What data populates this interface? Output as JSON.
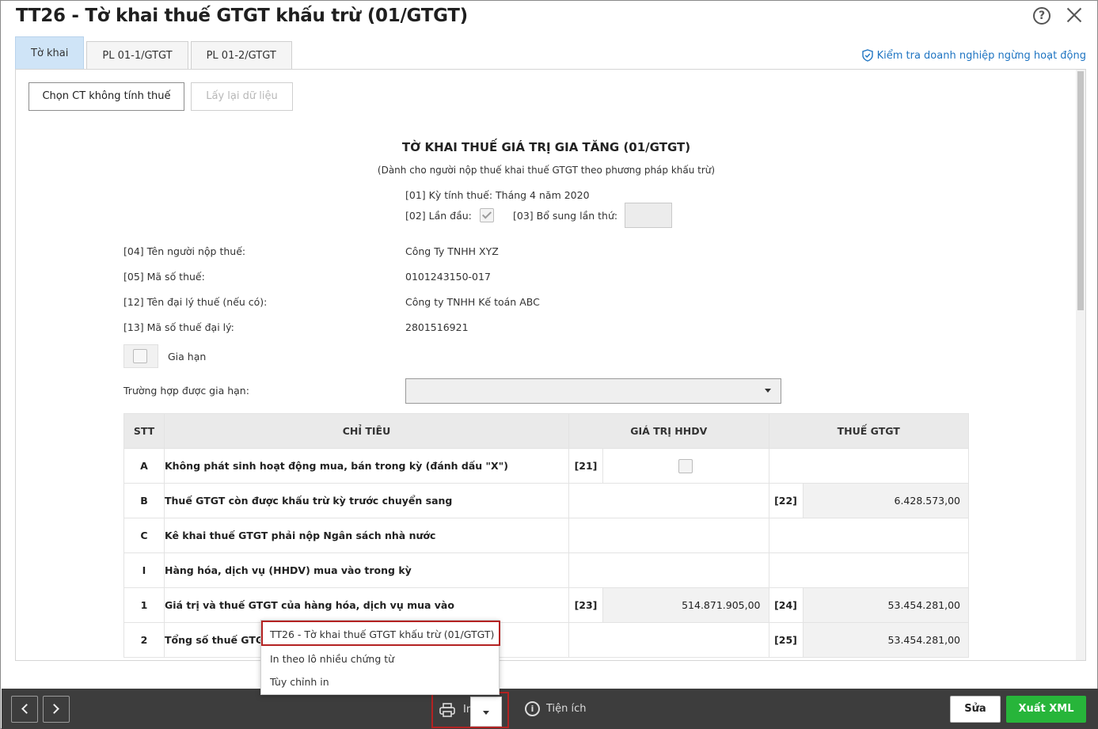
{
  "window": {
    "title": "TT26 - Tờ khai thuế GTGT khấu trừ (01/GTGT)"
  },
  "tabs": [
    "Tờ khai",
    "PL 01-1/GTGT",
    "PL 01-2/GTGT"
  ],
  "check_business_link": "Kiểm tra doanh nghiệp ngừng hoạt động",
  "toolbar": {
    "choose_btn": "Chọn CT không tính thuế",
    "reload_btn": "Lấy lại dữ liệu"
  },
  "form": {
    "title": "TỜ KHAI THUẾ GIÁ TRỊ GIA TĂNG (01/GTGT)",
    "subtitle": "(Dành cho người nộp thuế khai thuế GTGT theo phương pháp khấu trừ)",
    "period": "[01] Kỳ tính thuế: Tháng 4 năm 2020",
    "first_time_label": "[02] Lần đầu:",
    "supplement_label": "[03] Bổ sung lần thứ:",
    "supplement_value": "",
    "fields": [
      {
        "label": "[04] Tên người nộp thuế:",
        "value": "Công Ty TNHH XYZ"
      },
      {
        "label": "[05] Mã số thuế:",
        "value": "0101243150-017"
      },
      {
        "label": "[12] Tên đại lý thuế (nếu có):",
        "value": "Công ty TNHH Kế toán ABC"
      },
      {
        "label": "[13] Mã số thuế đại lý:",
        "value": "2801516921"
      }
    ],
    "extension_label": "Gia hạn",
    "extension_case_label": "Trường hợp được gia hạn:",
    "extension_case_value": ""
  },
  "table": {
    "headers": [
      "STT",
      "CHỈ TIÊU",
      "GIÁ TRỊ HHDV",
      "THUẾ GTGT"
    ],
    "rows": [
      {
        "stt": "A",
        "label": "Không phát sinh hoạt động mua, bán trong kỳ (đánh dấu \"X\")",
        "code1": "[21]"
      },
      {
        "stt": "B",
        "label": "Thuế GTGT còn được khấu trừ kỳ trước chuyển sang",
        "code2": "[22]",
        "val2": "6.428.573,00"
      },
      {
        "stt": "C",
        "label": "Kê khai thuế GTGT phải nộp Ngân sách nhà nước"
      },
      {
        "stt": "I",
        "label": "Hàng hóa, dịch vụ (HHDV) mua vào trong kỳ"
      },
      {
        "stt": "1",
        "label": "Giá trị và thuế GTGT của hàng hóa, dịch vụ mua vào",
        "code1": "[23]",
        "val1": "514.871.905,00",
        "code2": "[24]",
        "val2": "53.454.281,00"
      },
      {
        "stt": "2",
        "label": "Tổng số thuế GTGT",
        "code2": "[25]",
        "val2": "53.454.281,00"
      }
    ]
  },
  "print_menu": {
    "items": [
      "TT26 - Tờ khai thuế GTGT khấu trừ (01/GTGT)",
      "In theo lô nhiều chứng từ",
      "Tùy chỉnh in"
    ]
  },
  "footer": {
    "print_label": "In",
    "utility_label": "Tiện ích",
    "edit_btn": "Sửa",
    "export_btn": "Xuất XML"
  }
}
